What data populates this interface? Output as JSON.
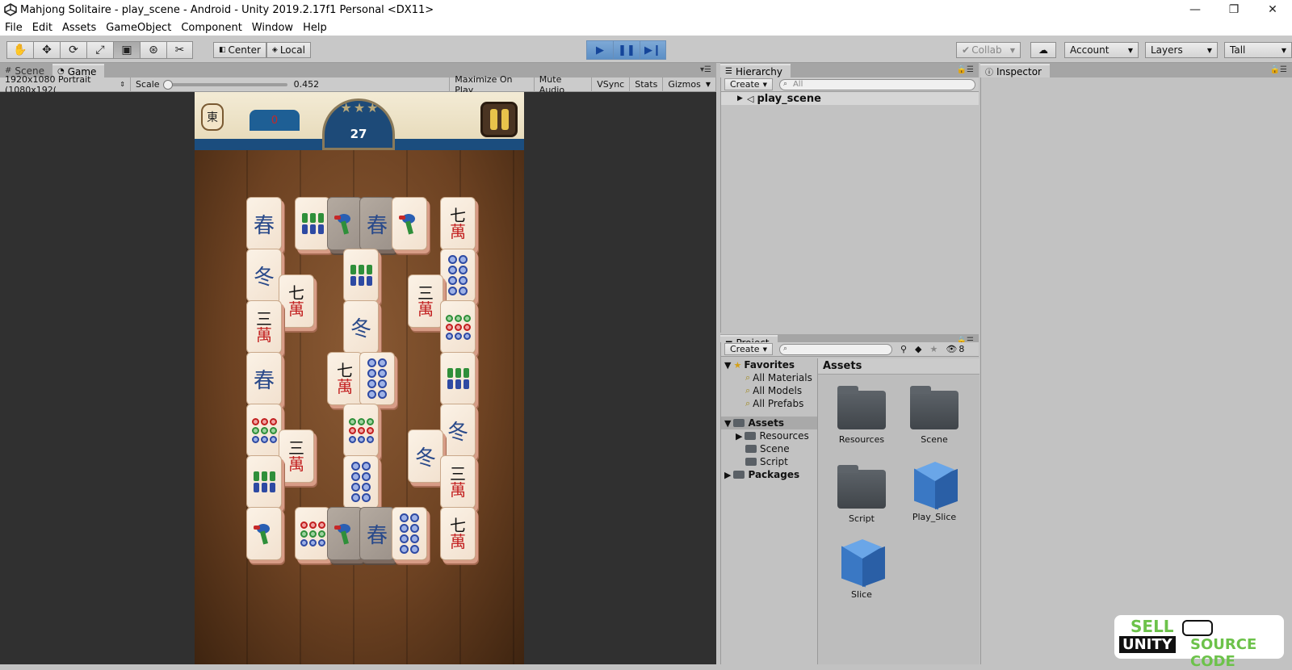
{
  "window": {
    "title": "Mahjong Solitaire - play_scene - Android - Unity 2019.2.17f1 Personal <DX11>",
    "controls": [
      "—",
      "❐",
      "✕"
    ]
  },
  "menu": [
    "File",
    "Edit",
    "Assets",
    "GameObject",
    "Component",
    "Window",
    "Help"
  ],
  "toolbar": {
    "transform_tools": [
      "hand-icon",
      "move-icon",
      "rotate-icon",
      "scale-icon",
      "rect-icon",
      "transform-icon",
      "custom-tool-icon"
    ],
    "pivot_label": "Center",
    "space_label": "Local",
    "collab_label": "Collab",
    "account_label": "Account",
    "layers_label": "Layers",
    "layout_label": "Tall"
  },
  "tabs": {
    "scene": "Scene",
    "game": "Game",
    "hierarchy": "Hierarchy",
    "inspector": "Inspector",
    "project": "Project"
  },
  "game_toolbar": {
    "resolution": "1920x1080 Portrait (1080x192(",
    "scale_label": "Scale",
    "scale_value": "0.452",
    "scale_fraction": 0.0,
    "maximize": "Maximize On Play",
    "mute": "Mute Audio",
    "vsync": "VSync",
    "stats": "Stats",
    "gizmos": "Gizmos"
  },
  "game": {
    "east_tile": "東",
    "score": "0",
    "moves": "27"
  },
  "hierarchy": {
    "create": "Create",
    "search_placeholder": "All",
    "scene_name": "play_scene"
  },
  "project": {
    "create": "Create",
    "hidden_count": "8",
    "favorites": "Favorites",
    "favorite_items": [
      "All Materials",
      "All Models",
      "All Prefabs"
    ],
    "assets_root": "Assets",
    "asset_folders": [
      "Resources",
      "Scene",
      "Script"
    ],
    "packages": "Packages",
    "assets_header": "Assets",
    "assets": [
      {
        "name": "Resources",
        "kind": "folder"
      },
      {
        "name": "Scene",
        "kind": "folder"
      },
      {
        "name": "Script",
        "kind": "folder"
      },
      {
        "name": "Play_Slice",
        "kind": "prefab"
      },
      {
        "name": "Slice",
        "kind": "prefab"
      }
    ]
  },
  "watermark": {
    "sell": "SELL",
    "unity": "UNITY",
    "source": "SOURCE CODE"
  },
  "colors": {
    "play_accent": "#5c8fc6",
    "editor_bg": "#c2c2c2",
    "game_bg": "#303030",
    "hud_blue": "#1b4d7e",
    "tile_face": "#fbf2e6",
    "watermark_green": "#6cc24a"
  }
}
